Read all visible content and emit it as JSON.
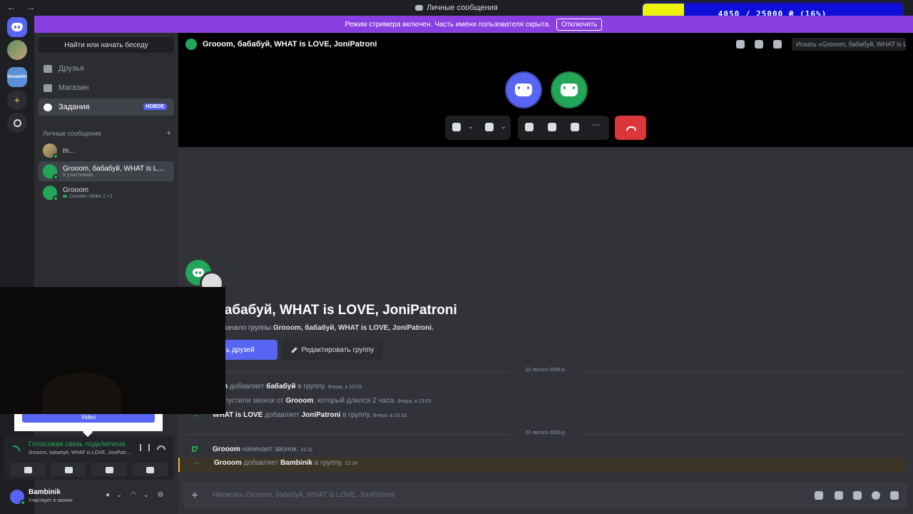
{
  "titlebar": {
    "nav": "← →",
    "title": "Личные сообщения"
  },
  "streamer": {
    "text": "Режим стримера включен. Часть имени пользователя скрыта.",
    "button": "Отключить"
  },
  "donation": {
    "text": "4050 / 25000 ₴ (16%)",
    "fraction": 0.16,
    "fill_color": "#ebf20b",
    "bg_color": "#0d0fd9"
  },
  "servers": [
    {
      "name": "home",
      "icon": "discord-icon"
    },
    {
      "name": "group",
      "icon": "avatar"
    },
    {
      "name": "Donatello",
      "label": "Donatello"
    },
    {
      "name": "add-server",
      "icon": "plus-icon"
    },
    {
      "name": "explore",
      "icon": "compass-icon"
    }
  ],
  "sidebar": {
    "search": "Найти или начать беседу",
    "nav": [
      {
        "label": "Друзья",
        "icon": "friends-icon"
      },
      {
        "label": "Магазин",
        "icon": "shop-icon"
      },
      {
        "label": "Задания",
        "icon": "quests-icon",
        "badge": "НОВОЕ"
      }
    ],
    "dm_header": "Личные сообщения",
    "dm_add": "+",
    "dms": [
      {
        "name": "m...",
        "sub": ""
      },
      {
        "name": "Grooom, бабабуй, WHAT is LOVE, JoniPatroni",
        "sub": "5 участников"
      },
      {
        "name": "Grooom",
        "sub": "Counter-Strike 2",
        "extra": "+1"
      }
    ]
  },
  "webcam": {
    "tip": "Video"
  },
  "voice": {
    "status": "Голосовая связь подключена",
    "channel": "Grooom, бабабуй, WHAT is LOVE, JoniPatroni"
  },
  "user": {
    "name": "Bambinik",
    "status": "Участвует в звонке"
  },
  "header": {
    "title": "Grooom, бабабуй, WHAT is LOVE, JoniPatroni",
    "search_placeholder": "Искать «Grooom, бабабуй, WHAT is LOVE, JoniPatroni»"
  },
  "intro": {
    "title": "om, бабабуй, WHAT is LOVE, JoniPatroni",
    "sub_prefix": "оловать в начало группы",
    "sub_name": "Grooom, бабабуй, WHAT is LOVE, JoniPatroni.",
    "invite": "асить друзей",
    "edit": "Редактировать группу"
  },
  "messages": {
    "date1": "22 лютого 2026 р.",
    "m1": {
      "author": "oom",
      "action": "добавляет",
      "target": "бабабуй",
      "tail": "в группу.",
      "time": "Вчера, в 23:03"
    },
    "m2": {
      "prefix": "пропустили звонок от",
      "author": "Grooom",
      "tail": ", который длился 2 часа.",
      "time": "Вчера, в 23:03"
    },
    "m3": {
      "author": "WHAT is LOVE",
      "action": "добавляет",
      "target": "JoniPatroni",
      "tail": "в группу.",
      "time": "Вчера, в 23:18"
    },
    "date2": "23 лютого 2026 р.",
    "m4": {
      "author": "Grooom",
      "action": "начинает звонок.",
      "time": "22:11"
    },
    "m5": {
      "author": "Grooom",
      "action": "добавляет",
      "target": "Bambinik",
      "tail": "в группу.",
      "time": "22:34"
    }
  },
  "composer": {
    "placeholder": "Написать Grooom, бабабуй, WHAT is LOVE, JoniPatroni"
  },
  "colors": {
    "accent": "#5865f2",
    "online": "#23a55a",
    "danger": "#da373c",
    "streamer": "#8a3fe0"
  }
}
